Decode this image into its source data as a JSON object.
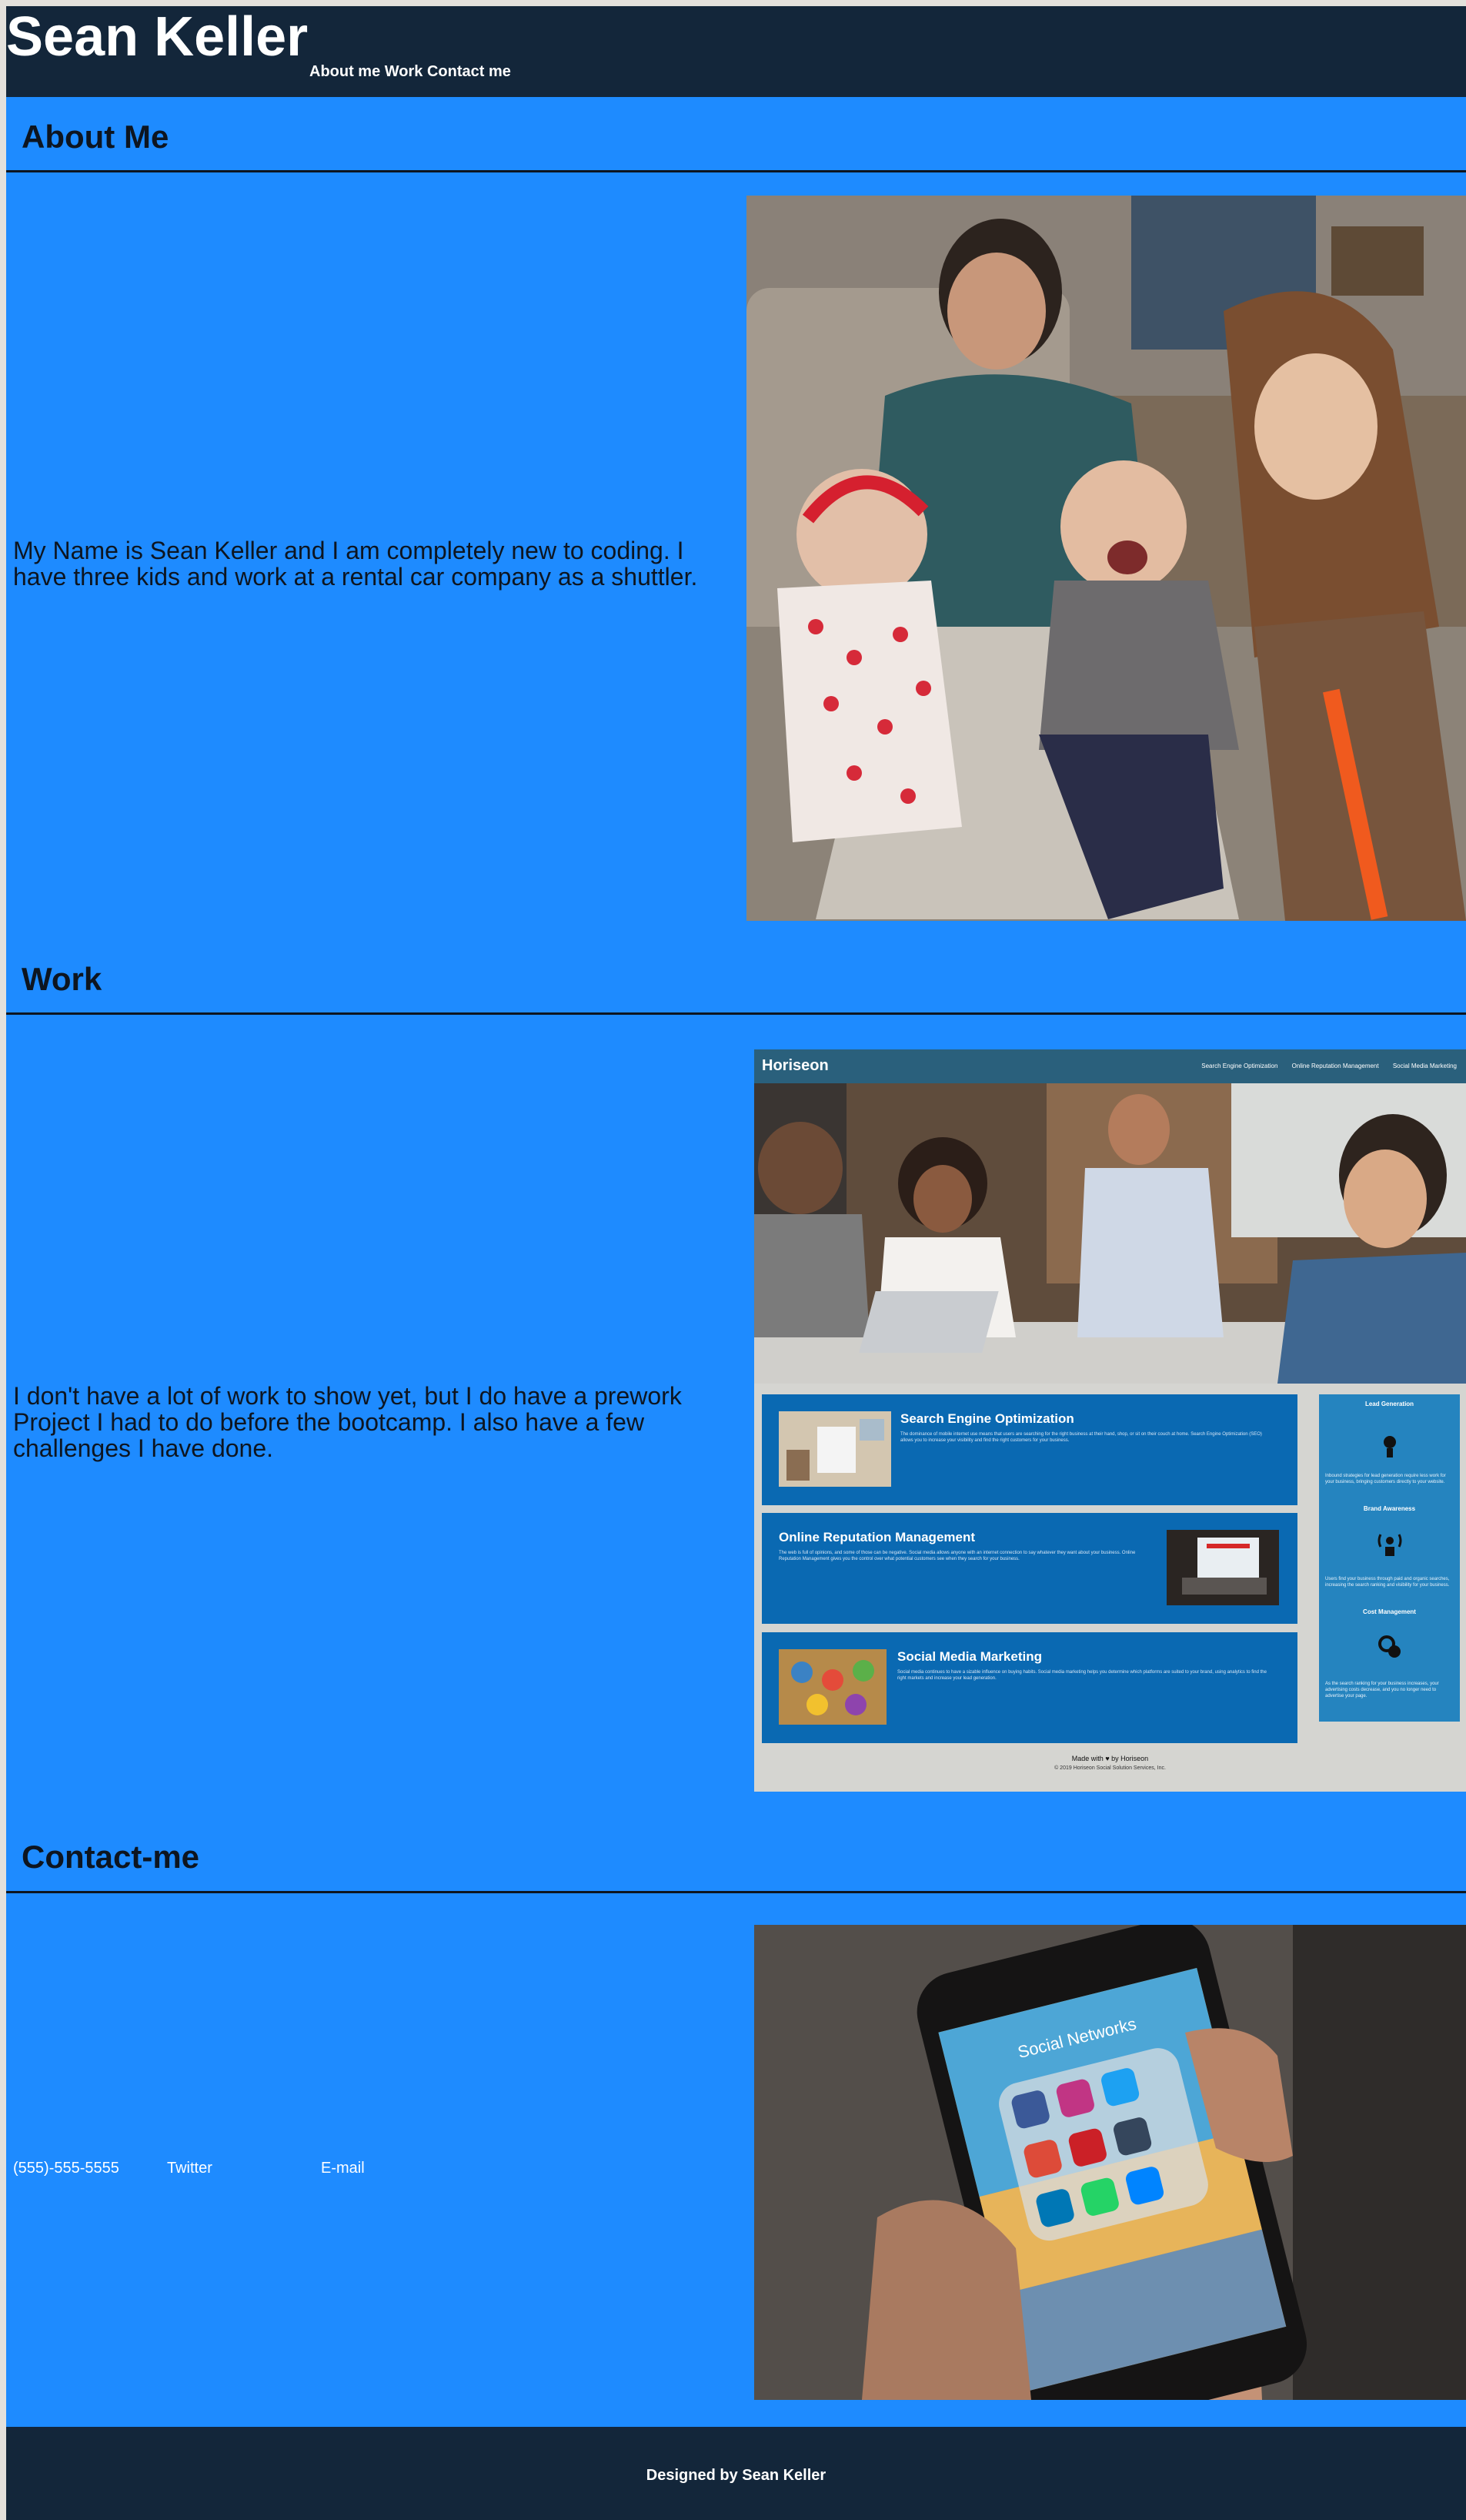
{
  "header": {
    "title": "Sean Keller",
    "nav": [
      "About me",
      "Work",
      "Contact me"
    ]
  },
  "about": {
    "heading": "About Me",
    "text": "My Name is Sean Keller and I am completely new to coding. I have three kids and work at a rental car company as a shuttler."
  },
  "work": {
    "heading": "Work",
    "text": "I don't have a lot of work to show yet, but I do have a prework Project I had to do before the bootcamp. I also have a few challenges I have done.",
    "project": {
      "logo": "Horiseon",
      "nav": [
        "Search Engine Optimization",
        "Online Reputation Management",
        "Social Media Marketing"
      ],
      "cards": [
        {
          "title": "Search Engine Optimization",
          "text": "The dominance of mobile internet use means that users are searching for the right business at their hand, shop, or sit on their couch at home. Search Engine Optimization (SEO) allows you to increase your visibility and find the right customers for your business."
        },
        {
          "title": "Online Reputation Management",
          "text": "The web is full of opinions, and some of those can be negative. Social media allows anyone with an internet connection to say whatever they want about your business. Online Reputation Management gives you the control over what potential customers see when they search for your business."
        },
        {
          "title": "Social Media Marketing",
          "text": "Social media continues to have a sizable influence on buying habits. Social media marketing helps you determine which platforms are suited to your brand, using analytics to find the right markets and increase your lead generation."
        }
      ],
      "benefits": [
        {
          "title": "Lead Generation",
          "text": "Inbound strategies for lead generation require less work for your business, bringing customers directly to your website."
        },
        {
          "title": "Brand Awareness",
          "text": "Users find your business through paid and organic searches, increasing the search ranking and visibility for your business."
        },
        {
          "title": "Cost Management",
          "text": "As the search ranking for your business increases, your advertising costs decrease, and you no longer need to advertise your page."
        }
      ],
      "footer": "Made with ♥ by Horiseon",
      "copyright": "© 2019 Horiseon Social Solution Services, Inc."
    }
  },
  "contact": {
    "heading": "Contact-me",
    "phone": "(555)-555-5555",
    "twitter": "Twitter",
    "email": "E-mail",
    "photo_caption": "Social Networks"
  },
  "footer": {
    "text": "Designed by Sean Keller"
  },
  "colors": {
    "page_bg": "#1e8bff",
    "header_bg": "#13263a",
    "text_dark": "#0d1520"
  }
}
